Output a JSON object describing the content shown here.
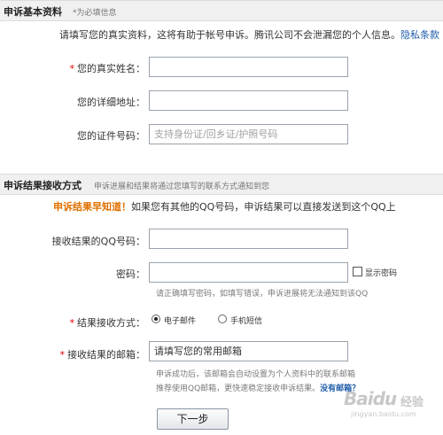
{
  "section1": {
    "title": "申诉基本资料",
    "required_note": "*为必填信息",
    "intro": "请填写您的真实资料，这将有助于帐号申诉。腾讯公司不会泄漏您的个人信息。",
    "privacy_link": "隐私条款",
    "real_name": {
      "label": "您的真实姓名：",
      "required": "*",
      "value": "",
      "placeholder": ""
    },
    "address": {
      "label": "您的详细地址：",
      "value": "",
      "placeholder": ""
    },
    "id_number": {
      "label": "您的证件号码：",
      "value": "",
      "placeholder": "支持身份证/回乡证/护照号码"
    }
  },
  "section2": {
    "title": "申诉结果接收方式",
    "hint": "申诉进展和结果将通过您填写的联系方式通知到您",
    "highlight": "申诉结果早知道！",
    "highlight_text": "如果您有其他的QQ号码，申诉结果可以直接发送到这个QQ上",
    "qq": {
      "label": "接收结果的QQ号码：",
      "value": "",
      "placeholder": ""
    },
    "password": {
      "label": "密码：",
      "value": "",
      "show_password_label": "显示密码",
      "hint": "请正确填写密码，如填写错误，申诉进展将无法通知到该QQ"
    },
    "method": {
      "label": "结果接收方式：",
      "required": "*",
      "options": [
        "电子邮件",
        "手机短信"
      ],
      "selected": "电子邮件"
    },
    "email": {
      "label": "接收结果的邮箱：",
      "required": "*",
      "value": "请填写您的常用邮箱",
      "hint1": "申诉成功后，该邮箱会自动设置为个人资料中的联系邮箱",
      "hint2": "推荐使用QQ邮箱，更快速稳定接收申诉结果。",
      "no_email_link": "没有邮箱？"
    },
    "next_button": "下一步"
  },
  "watermark": {
    "logo_text": "Baidu",
    "logo_sub": "经验",
    "url": "jingyan.baidu.com"
  }
}
